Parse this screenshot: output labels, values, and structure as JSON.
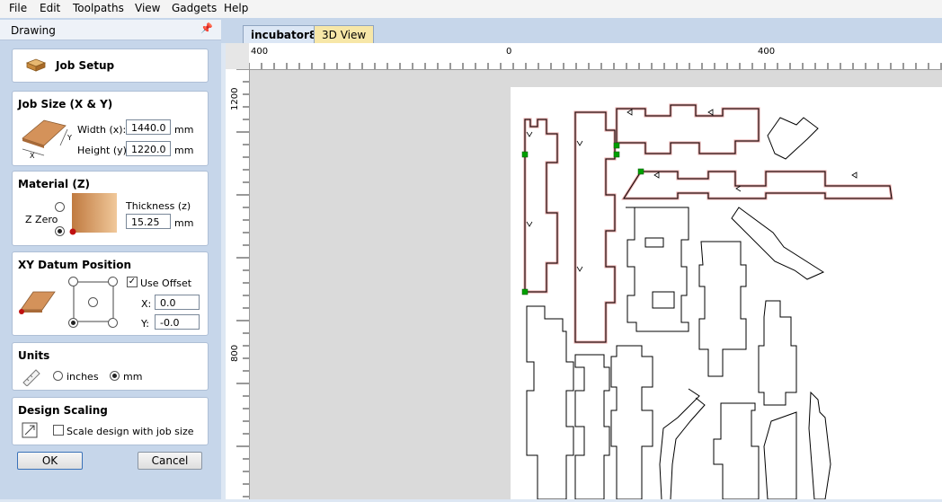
{
  "menu": [
    "File",
    "Edit",
    "Toolpaths",
    "View",
    "Gadgets",
    "Help"
  ],
  "panel": {
    "title": "Drawing",
    "pin": "📌"
  },
  "job_setup": {
    "title": "Job Setup"
  },
  "job_size": {
    "title": "Job Size (X & Y)",
    "width_label": "Width (x):",
    "width_value": "1440.0",
    "width_unit": "mm",
    "height_label": "Height (y):",
    "height_value": "1220.0",
    "height_unit": "mm",
    "axis_x": "X",
    "axis_y": "Y"
  },
  "material": {
    "title": "Material (Z)",
    "zzero_label": "Z Zero",
    "thickness_label": "Thickness (z)",
    "thickness_value": "15.25",
    "thickness_unit": "mm"
  },
  "datum": {
    "title": "XY Datum Position",
    "use_offset": "Use Offset",
    "use_offset_checked": true,
    "x_label": "X:",
    "x_value": "0.0",
    "y_label": "Y:",
    "y_value": "-0.0"
  },
  "units": {
    "title": "Units",
    "inches": "inches",
    "mm": "mm",
    "selected": "mm"
  },
  "scaling": {
    "title": "Design Scaling",
    "checkbox_label": "Scale design with job size",
    "checked": false
  },
  "buttons": {
    "ok": "OK",
    "cancel": "Cancel"
  },
  "tabs": [
    {
      "label": "incubator8",
      "active": true
    },
    {
      "label": "3D View",
      "active": false
    }
  ],
  "ruler": {
    "h_labels": [
      "400",
      "0",
      "400"
    ],
    "v_labels": [
      "1200",
      "800"
    ]
  },
  "colors": {
    "panel_bg": "#c6d6ea",
    "tab_active": "#dce7f5",
    "tab_3d": "#f7e7a8",
    "node_green": "#00a000"
  }
}
